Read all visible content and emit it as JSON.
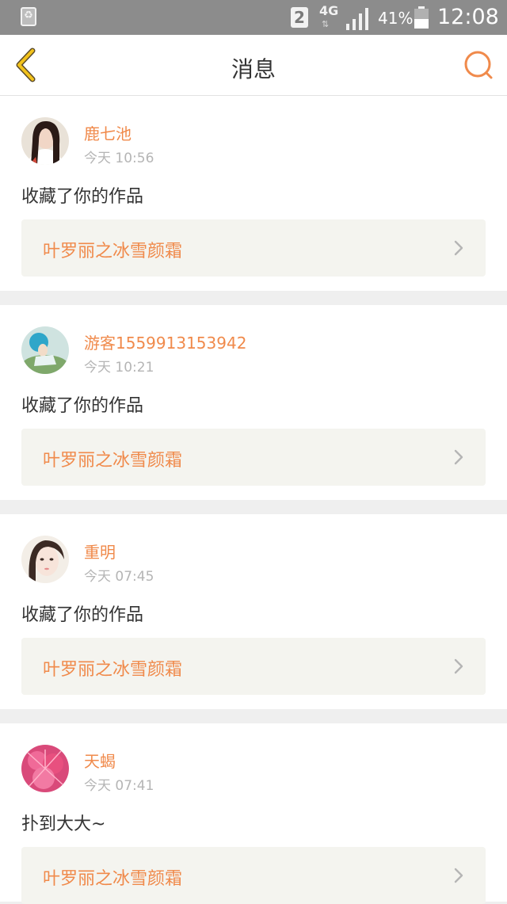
{
  "status_bar": {
    "sim_slot": "2",
    "network": "4G",
    "battery_percent": "41%",
    "time": "12:08"
  },
  "header": {
    "title": "消息",
    "back_icon": "back-chevron-icon",
    "search_icon": "search-icon"
  },
  "colors": {
    "accent": "#f08a4b",
    "back_arrow": "#f2b21b",
    "text_primary": "#333333",
    "text_secondary": "#b5b5b5",
    "card_link_bg": "#f4f4ef"
  },
  "messages": [
    {
      "name": "鹿七池",
      "time": "今天 10:56",
      "text": "收藏了你的作品",
      "work": "叶罗丽之冰雪颜霜"
    },
    {
      "name": "游客1559913153942",
      "time": "今天 10:21",
      "text": "收藏了你的作品",
      "work": "叶罗丽之冰雪颜霜"
    },
    {
      "name": "重明",
      "time": "今天 07:45",
      "text": "收藏了你的作品",
      "work": "叶罗丽之冰雪颜霜"
    },
    {
      "name": "天蝎",
      "time": "今天 07:41",
      "text": "扑到大大~",
      "work": "叶罗丽之冰雪颜霜"
    }
  ]
}
